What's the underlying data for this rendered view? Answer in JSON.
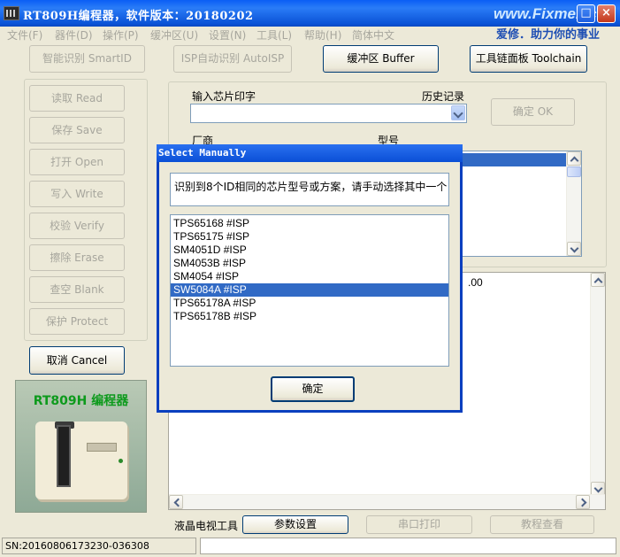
{
  "window": {
    "title": "RT809H编程器，软件版本：20180202",
    "controls": {
      "maximize": "□",
      "close": "×"
    }
  },
  "brand": {
    "url": "www.Fixme.cc",
    "slogan": "爱修．助力你的事业"
  },
  "menu": [
    "文件(F)",
    "器件(D)",
    "操作(P)",
    "缓冲区(U)",
    "设置(N)",
    "工具(L)",
    "帮助(H)",
    "简体中文"
  ],
  "top_buttons": {
    "smart_id": "智能识别 SmartID",
    "isp_auto": "ISP自动识别 AutoISP",
    "buffer": "缓冲区 Buffer",
    "toolchain": "工具链面板 Toolchain"
  },
  "side_buttons": [
    "读取 Read",
    "保存 Save",
    "打开 Open",
    "写入 Write",
    "校验 Verify",
    "擦除 Erase",
    "查空 Blank",
    "保护 Protect"
  ],
  "cancel_button": "取消 Cancel",
  "chip_input": {
    "label": "输入芯片印字",
    "history_label": "历史记录",
    "value": "",
    "ok_button": "确定 OK",
    "vendor_label": "厂商",
    "model_label": "型号"
  },
  "log": {
    "visible_text": ".00"
  },
  "product": {
    "title": "RT809H 编程器"
  },
  "bottom_bar": {
    "lcd_tools_label": "液晶电视工具",
    "param_settings": "参数设置",
    "serial_print": "串口打印",
    "tutorial": "教程查看"
  },
  "status": {
    "sn": "SN:20160806173230-036308",
    "message": ""
  },
  "dialog": {
    "title": "Select Manually",
    "message": "识别到8个ID相同的芯片型号或方案，请手动选择其中一个",
    "items": [
      "TPS65168 #ISP",
      "TPS65175 #ISP",
      "SM4051D #ISP",
      "SM4053B #ISP",
      "SM4054 #ISP",
      "SW5084A #ISP",
      "TPS65178A #ISP",
      "TPS65178B #ISP"
    ],
    "selected_index": 5,
    "confirm_button": "确定"
  },
  "colors": {
    "titlebar": "#0a52d6",
    "selection": "#316ac5",
    "face": "#ece9d8",
    "product_title": "#0d9a1c"
  }
}
